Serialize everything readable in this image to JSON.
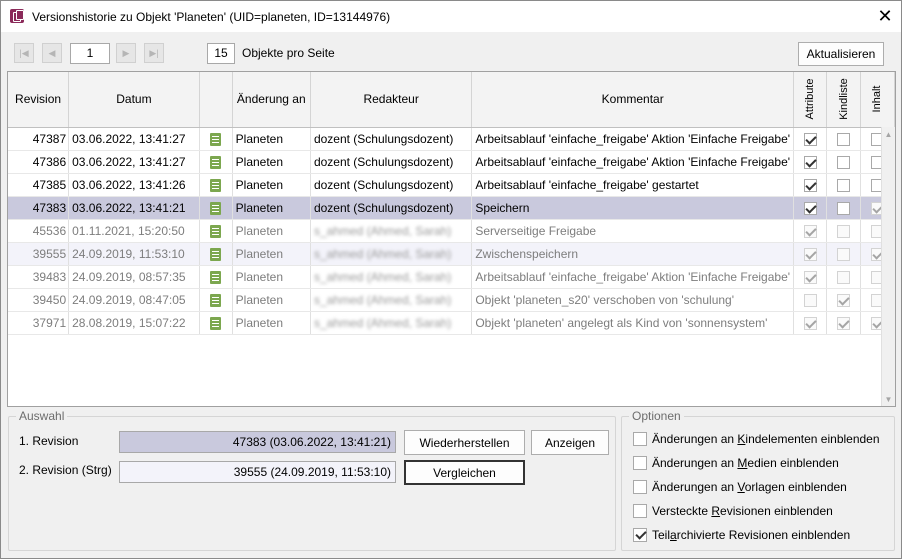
{
  "window": {
    "title": "Versionshistorie zu Objekt 'Planeten' (UID=planeten, ID=13144976)",
    "close_glyph": "✕"
  },
  "pager": {
    "page": "1",
    "per_page": "15",
    "per_page_label": "Objekte pro Seite",
    "refresh_label": "Aktualisieren"
  },
  "table": {
    "columns": [
      "Revision",
      "Datum",
      "",
      "Änderung an",
      "Redakteur",
      "Kommentar",
      "Attribute",
      "Kindliste",
      "Inhalt"
    ],
    "rows": [
      {
        "revision": "47387",
        "date": "03.06.2022, 13:41:27",
        "changed": "Planeten",
        "editor": "dozent (Schulungsdozent)",
        "comment": "Arbeitsablauf 'einfache_freigabe' Aktion 'Einfache Freigabe'",
        "attr": true,
        "kind": false,
        "inhalt": false,
        "state": "normal"
      },
      {
        "revision": "47386",
        "date": "03.06.2022, 13:41:27",
        "changed": "Planeten",
        "editor": "dozent (Schulungsdozent)",
        "comment": "Arbeitsablauf 'einfache_freigabe' Aktion 'Einfache Freigabe'",
        "attr": true,
        "kind": false,
        "inhalt": false,
        "state": "normal"
      },
      {
        "revision": "47385",
        "date": "03.06.2022, 13:41:26",
        "changed": "Planeten",
        "editor": "dozent (Schulungsdozent)",
        "comment": "Arbeitsablauf 'einfache_freigabe' gestartet",
        "attr": true,
        "kind": false,
        "inhalt": false,
        "state": "normal"
      },
      {
        "revision": "47383",
        "date": "03.06.2022, 13:41:21",
        "changed": "Planeten",
        "editor": "dozent (Schulungsdozent)",
        "comment": "Speichern",
        "attr": true,
        "kind": false,
        "inhalt": true,
        "state": "selected"
      },
      {
        "revision": "45536",
        "date": "01.11.2021, 15:20:50",
        "changed": "Planeten",
        "editor": "s_ahmed (Ahmed, Sarah)",
        "comment": "Serverseitige Freigabe",
        "attr": true,
        "kind": false,
        "inhalt": false,
        "state": "dim"
      },
      {
        "revision": "39555",
        "date": "24.09.2019, 11:53:10",
        "changed": "Planeten",
        "editor": "s_ahmed (Ahmed, Sarah)",
        "comment": "Zwischenspeichern",
        "attr": true,
        "kind": false,
        "inhalt": true,
        "state": "alt"
      },
      {
        "revision": "39483",
        "date": "24.09.2019, 08:57:35",
        "changed": "Planeten",
        "editor": "s_ahmed (Ahmed, Sarah)",
        "comment": "Arbeitsablauf 'einfache_freigabe' Aktion 'Einfache Freigabe'",
        "attr": true,
        "kind": false,
        "inhalt": false,
        "state": "dim"
      },
      {
        "revision": "39450",
        "date": "24.09.2019, 08:47:05",
        "changed": "Planeten",
        "editor": "s_ahmed (Ahmed, Sarah)",
        "comment": "Objekt 'planeten_s20' verschoben von 'schulung'",
        "attr": false,
        "kind": true,
        "inhalt": false,
        "state": "dim"
      },
      {
        "revision": "37971",
        "date": "28.08.2019, 15:07:22",
        "changed": "Planeten",
        "editor": "s_ahmed (Ahmed, Sarah)",
        "comment": "Objekt 'planeten' angelegt als Kind von 'sonnensystem'",
        "attr": true,
        "kind": true,
        "inhalt": true,
        "state": "dim"
      }
    ]
  },
  "auswahl": {
    "legend": "Auswahl",
    "rev1_label": "1. Revision",
    "rev1_value": "47383 (03.06.2022, 13:41:21)",
    "rev2_label": "2. Revision (Strg)",
    "rev2_value": "39555 (24.09.2019, 11:53:10)",
    "restore_label": "Wiederherstellen",
    "show_label": "Anzeigen",
    "compare_label": "Vergleichen"
  },
  "optionen": {
    "legend": "Optionen",
    "items": [
      {
        "pre": "Änderungen an ",
        "key": "K",
        "post": "indelementen einblenden",
        "checked": false
      },
      {
        "pre": "Änderungen an ",
        "key": "M",
        "post": "edien einblenden",
        "checked": false
      },
      {
        "pre": "Änderungen an ",
        "key": "V",
        "post": "orlagen einblenden",
        "checked": false
      },
      {
        "pre": "Versteckte ",
        "key": "R",
        "post": "evisionen einblenden",
        "checked": false
      },
      {
        "pre": "Teil",
        "key": "a",
        "post": "rchivierte Revisionen einblenden",
        "checked": true
      }
    ]
  },
  "colors": {
    "selected_row": "#c9c9dd",
    "alt_row": "#f3f3fa",
    "doc_icon": "#7ca74f",
    "app_icon": "#8b2a5a"
  }
}
